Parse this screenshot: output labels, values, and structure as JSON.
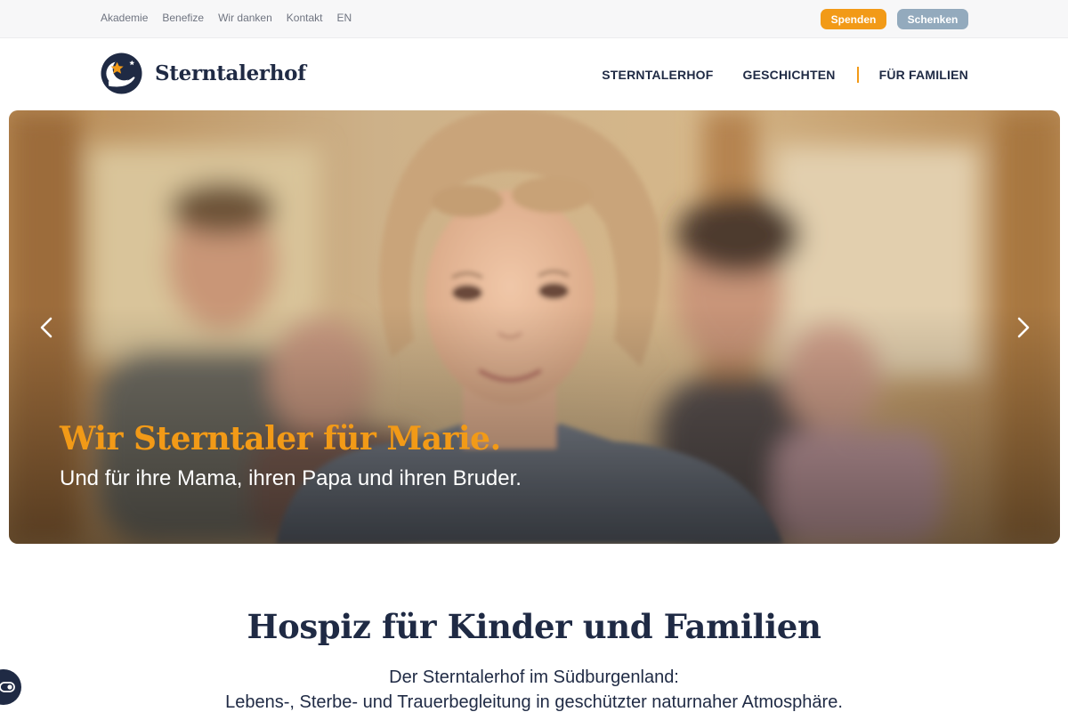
{
  "utility_bar": {
    "links": [
      "Akademie",
      "Benefize",
      "Wir danken",
      "Kontakt",
      "EN"
    ],
    "donate_label": "Spenden",
    "gift_label": "Schenken"
  },
  "header": {
    "logo_text": "Sterntalerhof",
    "nav": [
      "STERNTALERHOF",
      "GESCHICHTEN",
      "FÜR FAMILIEN"
    ]
  },
  "hero": {
    "title": "Wir Sterntaler für Marie.",
    "subtitle": "Und für ihre Mama, ihren Papa und ihren Bruder.",
    "prev_icon": "chevron-left-icon",
    "next_icon": "chevron-right-icon"
  },
  "intro": {
    "title": "Hospiz für Kinder und Familien",
    "line1": "Der Sterntalerhof im Südburgenland:",
    "line2": "Lebens-, Sterbe- und Trauerbegleitung in geschützter naturnaher Atmosphäre."
  },
  "colors": {
    "brand_navy": "#1f2a44",
    "accent_orange": "#f29a17",
    "gift_blue": "#93aabd"
  }
}
